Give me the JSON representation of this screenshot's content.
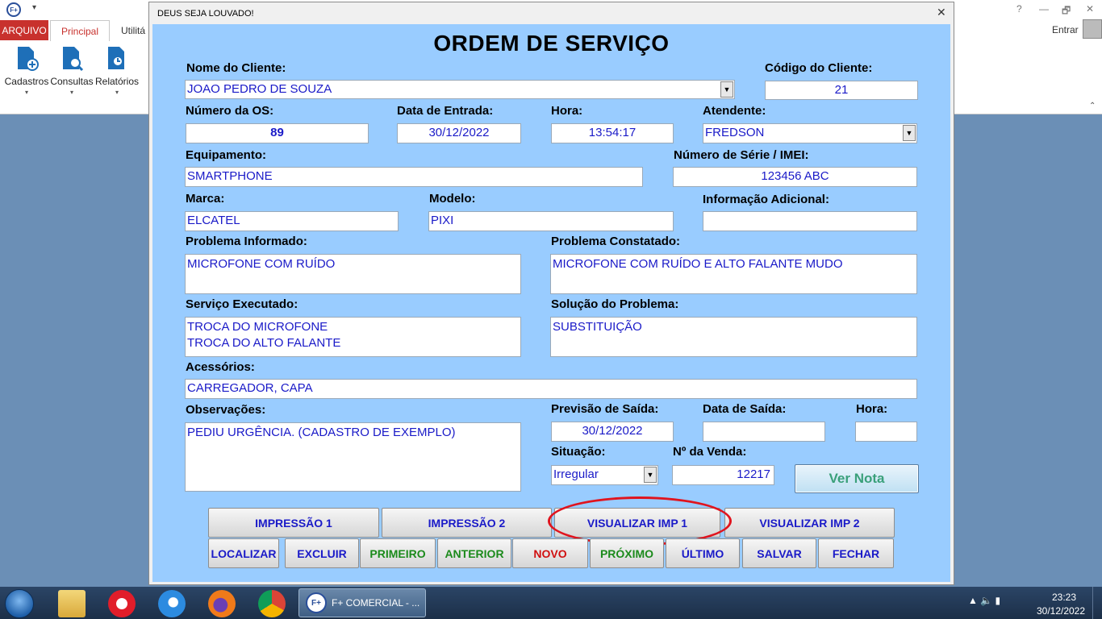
{
  "app": {
    "logo_text": "F+",
    "tabs": {
      "arquivo": "ARQUIVO",
      "principal": "Principal",
      "utilit": "Utilitá"
    },
    "ribbon": [
      {
        "label": "Cadastros"
      },
      {
        "label": "Consultas"
      },
      {
        "label": "Relatórios"
      }
    ],
    "controls": {
      "help": "?",
      "minimize": "—",
      "restore": "🗗",
      "close": "✕"
    },
    "entrar": "Entrar"
  },
  "dialog": {
    "window_title": "DEUS SEJA LOUVADO!",
    "close": "✕",
    "title": "ORDEM DE SERVIÇO",
    "labels": {
      "nome_cliente": "Nome do Cliente:",
      "codigo_cliente": "Código do Cliente:",
      "numero_os": "Número da OS:",
      "data_entrada": "Data de Entrada:",
      "hora": "Hora:",
      "atendente": "Atendente:",
      "equipamento": "Equipamento:",
      "numero_serie": "Número de Série / IMEI:",
      "marca": "Marca:",
      "modelo": "Modelo:",
      "info_adicional": "Informação Adicional:",
      "problema_informado": "Problema Informado:",
      "problema_constatado": "Problema Constatado:",
      "servico_executado": "Serviço Executado:",
      "solucao_problema": "Solução do Problema:",
      "acessorios": "Acessórios:",
      "observacoes": "Observações:",
      "previsao_saida": "Previsão de Saída:",
      "data_saida": "Data de Saída:",
      "hora_saida": "Hora:",
      "situacao": "Situação:",
      "numero_venda": "Nº da Venda:"
    },
    "values": {
      "nome_cliente": "JOAO PEDRO DE SOUZA",
      "codigo_cliente": "21",
      "numero_os": "89",
      "data_entrada": "30/12/2022",
      "hora": "13:54:17",
      "atendente": "FREDSON",
      "equipamento": "SMARTPHONE",
      "numero_serie": "123456 ABC",
      "marca": "ELCATEL",
      "modelo": "PIXI",
      "info_adicional": "",
      "problema_informado": "MICROFONE COM RUÍDO",
      "problema_constatado": "MICROFONE COM RUÍDO E ALTO FALANTE MUDO",
      "servico_executado": "TROCA DO MICROFONE\nTROCA DO ALTO FALANTE",
      "solucao_problema": "SUBSTITUIÇÃO",
      "acessorios": "CARREGADOR, CAPA",
      "observacoes": "PEDIU URGÊNCIA. (CADASTRO DE EXEMPLO)",
      "previsao_saida": "30/12/2022",
      "data_saida": "",
      "hora_saida": "",
      "situacao": "Irregular",
      "numero_venda": "12217"
    },
    "buttons": {
      "ver_nota": "Ver Nota",
      "impressao1": "IMPRESSÃO 1",
      "impressao2": "IMPRESSÃO 2",
      "visualizar1": "VISUALIZAR IMP 1",
      "visualizar2": "VISUALIZAR IMP 2",
      "localizar": "LOCALIZAR",
      "excluir": "EXCLUIR",
      "primeiro": "PRIMEIRO",
      "anterior": "ANTERIOR",
      "novo": "NOVO",
      "proximo": "PRÓXIMO",
      "ultimo": "ÚLTIMO",
      "salvar": "SALVAR",
      "fechar": "FECHAR"
    },
    "dropdown_arrow": "▼"
  },
  "taskbar": {
    "app_logo": "F+",
    "app_label": "F+ COMERCIAL - ...",
    "tray": "▲ 🔈 ▮",
    "time": "23:23",
    "date": "30/12/2022"
  },
  "colors": {
    "form_bg": "#99ccff",
    "value_text": "#1a1ac8",
    "highlight": "#e0141e"
  }
}
